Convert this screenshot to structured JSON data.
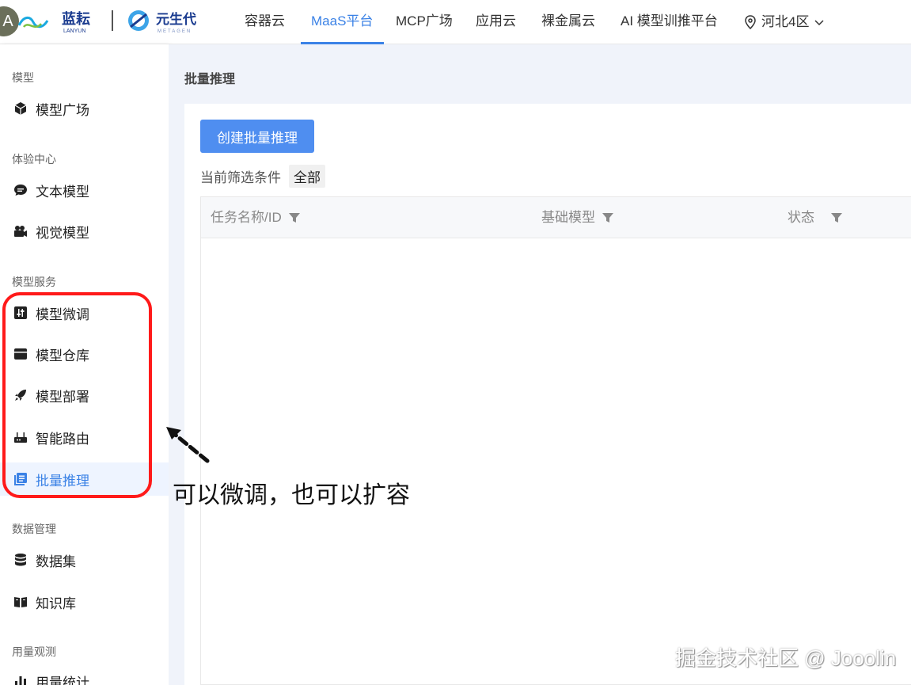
{
  "header": {
    "avatar_text": "A",
    "logo_primary_cn": "蓝耘",
    "logo_primary_en": "LANYUN",
    "logo_secondary_cn": "元生代",
    "logo_secondary_en": "METAGEN",
    "nav": [
      {
        "label": "容器云"
      },
      {
        "label": "MaaS平台",
        "active": true
      },
      {
        "label": "MCP广场"
      },
      {
        "label": "应用云"
      },
      {
        "label": "裸金属云"
      },
      {
        "label": "AI 模型训推平台"
      }
    ],
    "region": "河北4区"
  },
  "sidebar": {
    "sections": [
      {
        "title": "模型",
        "items": [
          {
            "label": "模型广场",
            "icon": "cube-icon"
          }
        ]
      },
      {
        "title": "体验中心",
        "items": [
          {
            "label": "文本模型",
            "icon": "chat-bubble-icon"
          },
          {
            "label": "视觉模型",
            "icon": "video-camera-icon"
          }
        ]
      },
      {
        "title": "模型服务",
        "items": [
          {
            "label": "模型微调",
            "icon": "sliders-icon"
          },
          {
            "label": "模型仓库",
            "icon": "archive-icon"
          },
          {
            "label": "模型部署",
            "icon": "rocket-icon"
          },
          {
            "label": "智能路由",
            "icon": "router-icon"
          },
          {
            "label": "批量推理",
            "icon": "batch-icon",
            "active": true
          }
        ]
      },
      {
        "title": "数据管理",
        "items": [
          {
            "label": "数据集",
            "icon": "database-icon"
          },
          {
            "label": "知识库",
            "icon": "book-icon"
          }
        ]
      },
      {
        "title": "用量观测",
        "items": [
          {
            "label": "用量统计",
            "icon": "bar-chart-icon"
          }
        ]
      }
    ]
  },
  "main": {
    "page_title": "批量推理",
    "create_button": "创建批量推理",
    "filter_label": "当前筛选条件",
    "filter_value": "全部",
    "columns": [
      {
        "label": "任务名称/ID"
      },
      {
        "label": "基础模型"
      },
      {
        "label": "状态"
      }
    ]
  },
  "annotation": {
    "text": "可以微调，也可以扩容",
    "color": "#ff1a1a"
  },
  "watermark": "掘金技术社区 @ Jooolin",
  "colors": {
    "accent": "#3b82e6",
    "button": "#4f8ef0"
  }
}
